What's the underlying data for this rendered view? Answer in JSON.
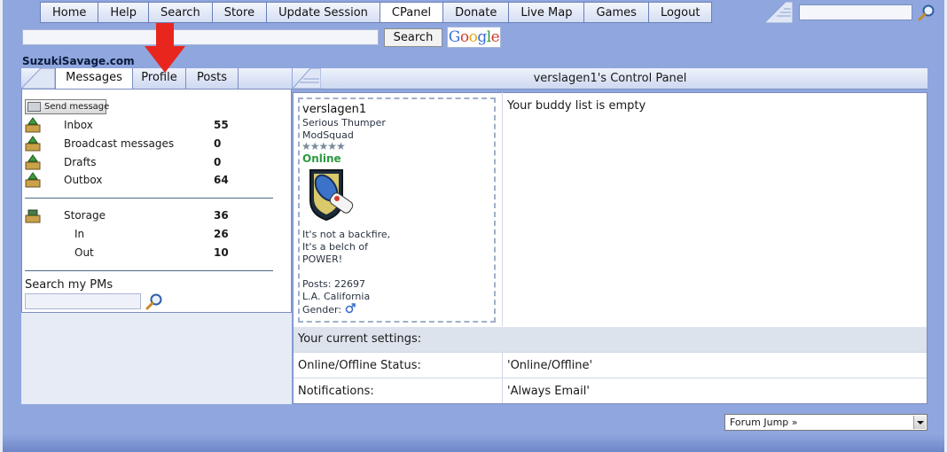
{
  "nav": {
    "items": [
      "Home",
      "Help",
      "Search",
      "Store",
      "Update Session",
      "CPanel",
      "Donate",
      "Live Map",
      "Games",
      "Logout"
    ],
    "active": "CPanel"
  },
  "google": {
    "button": "Search",
    "logo": "Google"
  },
  "site": {
    "name": "SuzukiSavage.com"
  },
  "tabs": {
    "messages": "Messages",
    "profile": "Profile",
    "posts": "Posts"
  },
  "left": {
    "send_button": "Send message",
    "folders": [
      {
        "label": "Inbox",
        "count": "55",
        "icon": "inbox-icon"
      },
      {
        "label": "Broadcast messages",
        "count": "0",
        "icon": "broadcast-icon"
      },
      {
        "label": "Drafts",
        "count": "0",
        "icon": "drafts-icon"
      },
      {
        "label": "Outbox",
        "count": "64",
        "icon": "outbox-icon"
      }
    ],
    "storage": {
      "label": "Storage",
      "count": "36",
      "in_label": "In",
      "in_count": "26",
      "out_label": "Out",
      "out_count": "10"
    },
    "search_label": "Search my PMs"
  },
  "panel": {
    "title": "verslagen1's Control Panel",
    "buddy_list": "Your buddy list is empty"
  },
  "profile": {
    "username": "verslagen1",
    "title": "Serious Thumper",
    "group": "ModSquad",
    "stars": "★★★★★",
    "status": "Online",
    "signature": [
      "It's not a backfire,",
      "It's a belch of",
      "POWER!"
    ],
    "posts": "Posts: 22697",
    "location": "L.A. California",
    "gender": "Gender:"
  },
  "settings": {
    "header": "Your current settings:",
    "rows": [
      {
        "key": "Online/Offline Status:",
        "value": "'Online/Offline'"
      },
      {
        "key": "Notifications:",
        "value": "'Always Email'"
      }
    ]
  },
  "footer": {
    "forum_jump": "Forum Jump »"
  },
  "colors": {
    "frame": "#8fa6de",
    "online": "#2c9a3e",
    "annotation_arrow": "#e8261e"
  }
}
